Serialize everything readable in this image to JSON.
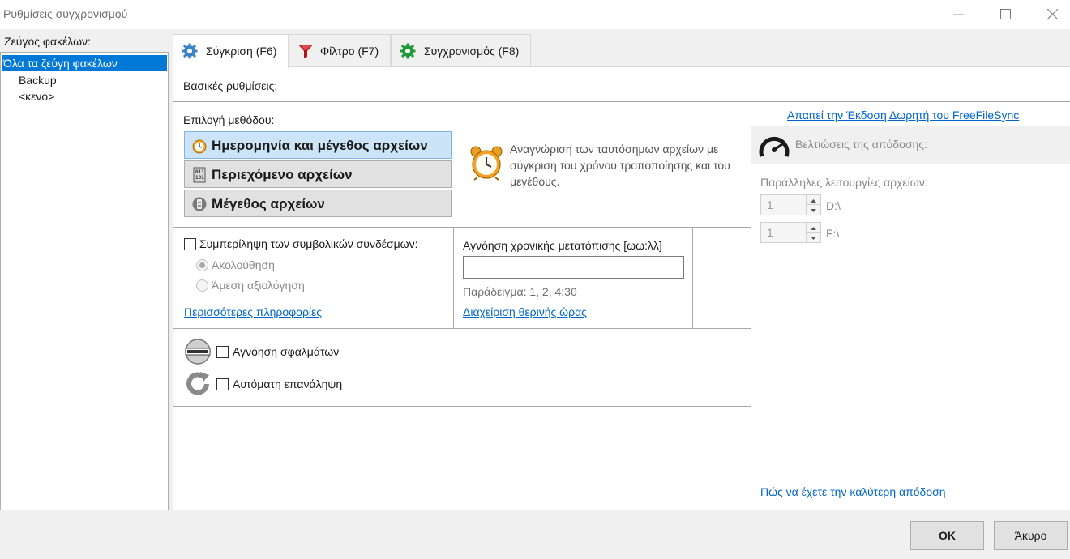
{
  "window": {
    "title": "Ρυθμίσεις συγχρονισμού"
  },
  "left_panel": {
    "label": "Ζεύγος φακέλων:",
    "items": [
      {
        "label": "Όλα τα ζεύγη φακέλων",
        "selected": true
      },
      {
        "label": "Backup"
      },
      {
        "label": "<κενό>"
      }
    ]
  },
  "tabs": [
    {
      "label": "Σύγκριση (F6)",
      "icon": "gear-icon",
      "active": true
    },
    {
      "label": "Φίλτρο (F7)",
      "icon": "funnel-icon"
    },
    {
      "label": "Συγχρονισμός (F8)",
      "icon": "sync-gear-icon"
    }
  ],
  "compare": {
    "section_title": "Βασικές ρυθμίσεις:",
    "method_label": "Επιλογή μεθόδου:",
    "methods": [
      {
        "label": "Ημερομηνία και μέγεθος αρχείων",
        "icon": "clock-icon",
        "active": true
      },
      {
        "label": "Περιεχόμενο αρχείων",
        "icon": "binary-file-icon"
      },
      {
        "label": "Μέγεθος αρχείων",
        "icon": "file-size-icon"
      }
    ],
    "method_description": "Αναγνώριση των ταυτόσημων αρχείων με σύγκριση του χρόνου τροποποίησης και του μεγέθους.",
    "symlinks": {
      "checkbox_label": "Συμπερίληψη των συμβολικών συνδέσμων:",
      "checked": false,
      "options": [
        {
          "label": "Ακολούθηση",
          "checked": true
        },
        {
          "label": "Άμεση αξιολόγηση",
          "checked": false
        }
      ],
      "more_info_link": "Περισσότερες πληροφορίες"
    },
    "time_shift": {
      "label": "Αγνόηση χρονικής μετατόπισης [ωω:λλ]",
      "value": "",
      "example": "Παράδειγμα: 1, 2, 4:30",
      "dst_link": "Διαχείριση θερινής ώρας"
    },
    "ignore_errors": {
      "label": "Αγνόηση σφαλμάτων",
      "checked": false
    },
    "auto_retry": {
      "label": "Αυτόματη επανάληψη",
      "checked": false
    }
  },
  "performance": {
    "donation_link": "Απαιτεί την Έκδοση Δωρητή του FreeFileSync",
    "title": "Βελτιώσεις της απόδοσης:",
    "parallel_label": "Παράλληλες λειτουργίες αρχείων:",
    "drives": [
      {
        "value": "1",
        "label": "D:\\"
      },
      {
        "value": "1",
        "label": "F:\\"
      }
    ],
    "best_performance_link": "Πώς να έχετε την καλύτερη απόδοση"
  },
  "buttons": {
    "ok": "OK",
    "cancel": "Άκυρο"
  },
  "colors": {
    "accent": "#0078d7",
    "link": "#0066cc",
    "method_active": "#cce4f7"
  }
}
